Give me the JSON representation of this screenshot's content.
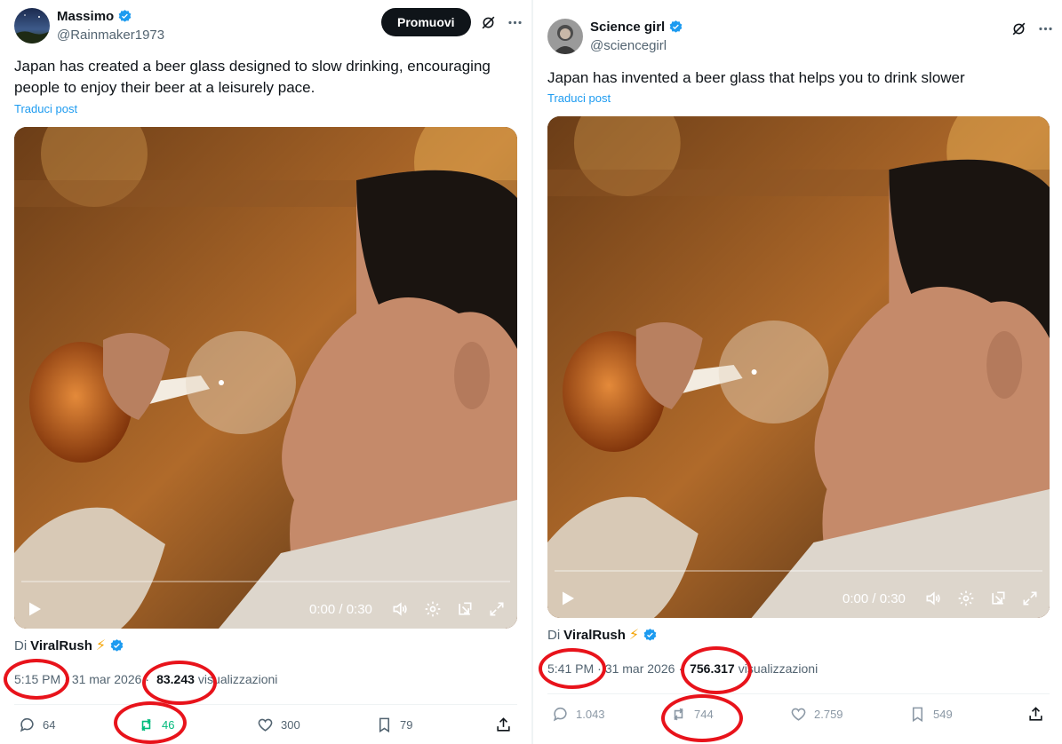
{
  "left_post": {
    "author": {
      "display_name": "Massimo",
      "handle": "@Rainmaker1973"
    },
    "promote_label": "Promuovi",
    "text": "Japan has created a beer glass designed to slow drinking, encouraging people to enjoy their beer at a leisurely pace.",
    "translate_label": "Traduci post",
    "video": {
      "time": "0:00 / 0:30",
      "progress": 0.0
    },
    "attribution": {
      "prefix": "Di",
      "owner": "ViralRush",
      "emoji": "⚡"
    },
    "meta": {
      "time": "5:15 PM",
      "date": "31 mar 2026",
      "views": "83.243",
      "views_label": "visualizzazioni"
    },
    "stats": {
      "replies": "64",
      "reposts": "46",
      "likes": "300",
      "bookmarks": "79"
    }
  },
  "right_post": {
    "author": {
      "display_name": "Science girl",
      "handle": "@sciencegirl"
    },
    "text": "Japan has invented a beer glass that helps you to drink slower",
    "translate_label": "Traduci post",
    "video": {
      "time": "0:00 / 0:30",
      "progress": 0.0
    },
    "attribution": {
      "prefix": "Di",
      "owner": "ViralRush",
      "emoji": "⚡"
    },
    "meta": {
      "time": "5:41 PM",
      "date": "31 mar 2026",
      "views": "756.317",
      "views_label": "visualizzazioni"
    },
    "stats": {
      "replies": "1.043",
      "reposts": "744",
      "likes": "2.759",
      "bookmarks": "549"
    }
  },
  "colors": {
    "accent_blue": "#1d9bf0",
    "retweet_green": "#00ba7c",
    "annotation_red": "#e8131b",
    "text_primary": "#0f1419",
    "text_secondary": "#536471"
  }
}
